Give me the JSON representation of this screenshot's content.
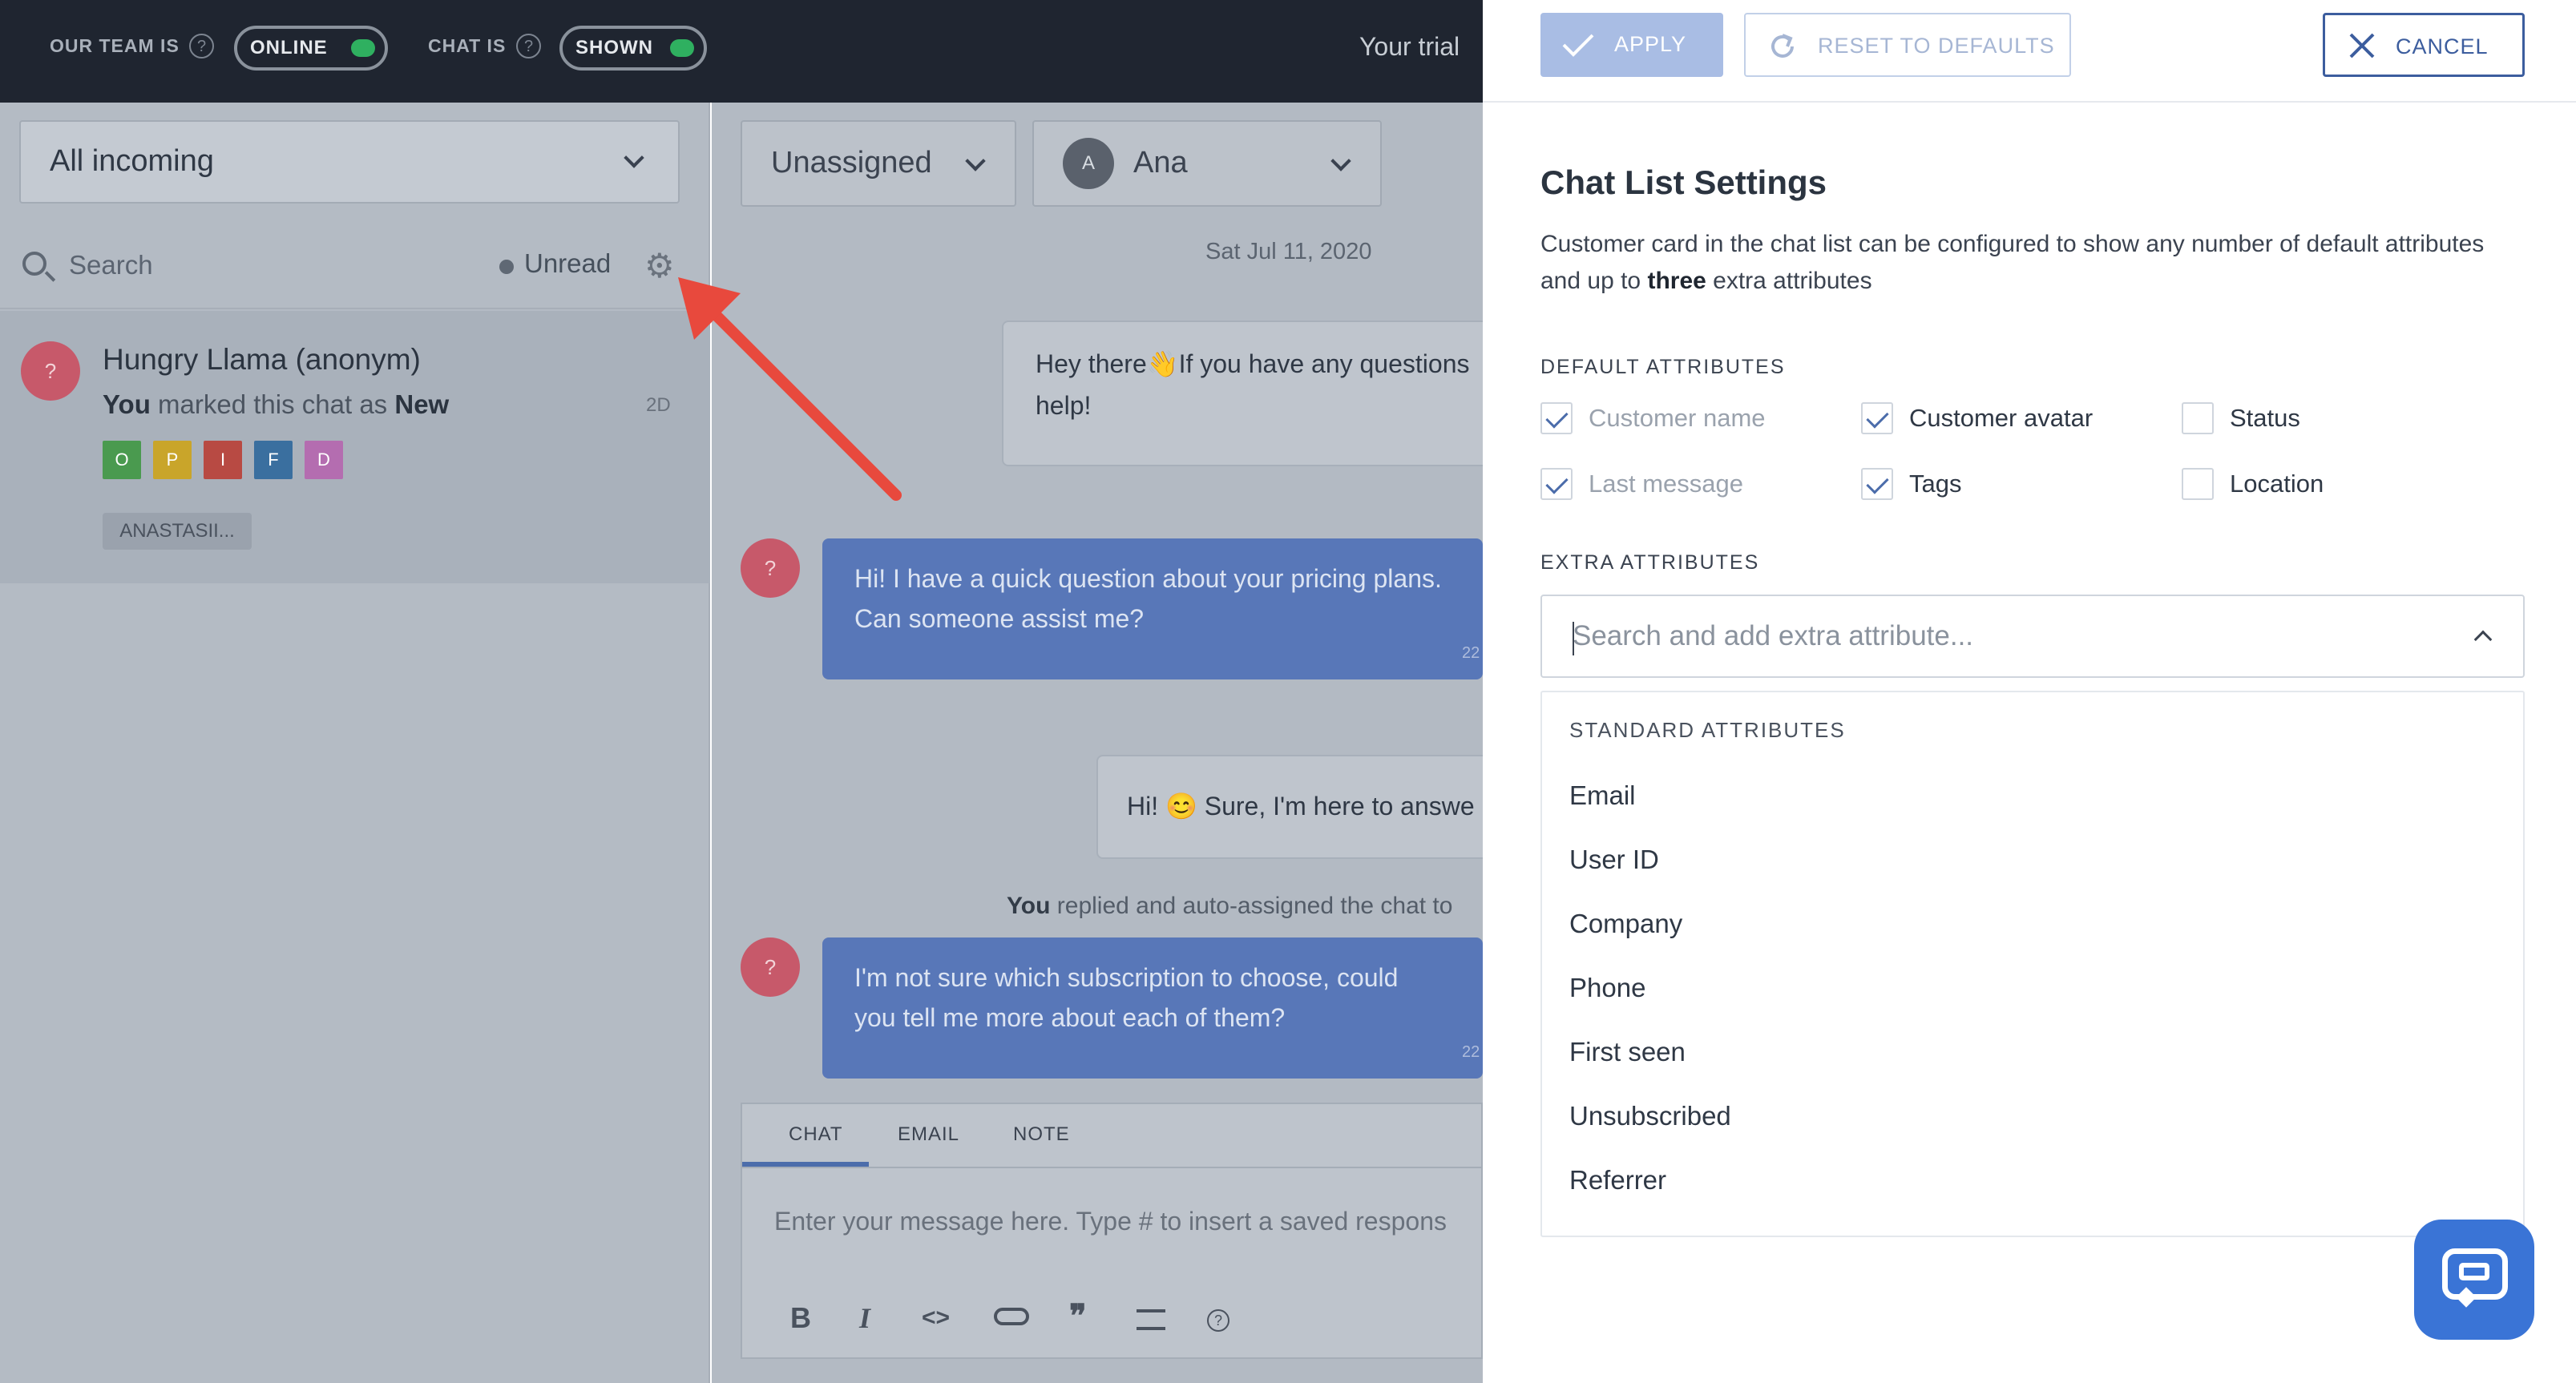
{
  "topbar": {
    "team_label": "OUR TEAM IS",
    "team_status": "ONLINE",
    "chat_label": "CHAT IS",
    "chat_status": "SHOWN",
    "help_glyph": "?",
    "trial_text": "Your trial"
  },
  "sidebar": {
    "filter": "All incoming",
    "search_placeholder": "Search",
    "unread_label": "Unread",
    "chat": {
      "avatar": "?",
      "name": "Hungry Llama (anonym)",
      "status_you": "You",
      "status_mid": " marked this chat as ",
      "status_value": "New",
      "time": "2D",
      "tags": [
        {
          "letter": "O",
          "color": "#4a9a4f"
        },
        {
          "letter": "P",
          "color": "#c9a52a"
        },
        {
          "letter": "I",
          "color": "#b84a43"
        },
        {
          "letter": "F",
          "color": "#3a6f9f"
        },
        {
          "letter": "D",
          "color": "#b46db0"
        }
      ],
      "agent": "ANASTASII..."
    }
  },
  "main": {
    "assignee_filter": "Unassigned",
    "agent_filter": "Ana",
    "agent_initial": "A",
    "date": "Sat Jul 11, 2020",
    "msg1_line1": "Hey there👋If you have any questions",
    "msg1_line2": "help!",
    "msg2_line1": "Hi! I have a quick question about your pricing plans.",
    "msg2_line2": "Can someone assist me?",
    "msg2_time": "22",
    "msg3": "Hi! 😊 Sure, I'm here to answe",
    "sys_you": "You",
    "sys_text": " replied and auto-assigned the chat to",
    "msg4_line1": "I'm not sure which subscription to choose, could",
    "msg4_line2": "you tell me more about each of them?",
    "msg4_time": "22",
    "composer": {
      "tabs": [
        "CHAT",
        "EMAIL",
        "NOTE"
      ],
      "placeholder": "Enter your message here. Type # to insert a saved respons",
      "tools": {
        "bold": "B",
        "italic": "I",
        "code": "<>",
        "quote": "❞",
        "help": "?"
      }
    }
  },
  "panel": {
    "apply": "APPLY",
    "reset": "RESET TO DEFAULTS",
    "cancel": "CANCEL",
    "title": "Chat List Settings",
    "desc_pre": "Customer card in the chat list can be configured to show any number of default attributes and up to ",
    "desc_bold": "three",
    "desc_post": " extra attributes",
    "default_heading": "DEFAULT ATTRIBUTES",
    "default_attrs": [
      {
        "label": "Customer name",
        "checked": true,
        "disabled": true
      },
      {
        "label": "Customer avatar",
        "checked": true,
        "disabled": false
      },
      {
        "label": "Status",
        "checked": false,
        "disabled": false
      },
      {
        "label": "Last message",
        "checked": true,
        "disabled": true
      },
      {
        "label": "Tags",
        "checked": true,
        "disabled": false
      },
      {
        "label": "Location",
        "checked": false,
        "disabled": false
      }
    ],
    "extra_heading": "EXTRA ATTRIBUTES",
    "extra_placeholder": "Search and add extra attribute...",
    "menu_heading": "STANDARD ATTRIBUTES",
    "menu_items": [
      "Email",
      "User ID",
      "Company",
      "Phone",
      "First seen",
      "Unsubscribed",
      "Referrer"
    ]
  },
  "colors": {
    "accent": "#3c5d9e",
    "apply_bg": "#a9bde4",
    "online_green": "#2fb060",
    "fab": "#3a74d6",
    "arrow": "#e8493d"
  }
}
